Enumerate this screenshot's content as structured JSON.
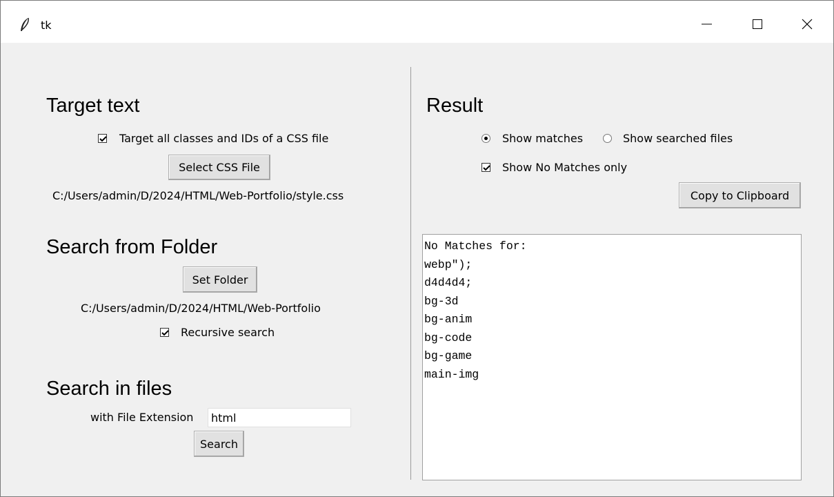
{
  "window": {
    "title": "tk",
    "icons": {
      "app": "feather-icon",
      "minimize": "minimize-icon",
      "maximize": "maximize-icon",
      "close": "close-icon"
    }
  },
  "left": {
    "target_heading": "Target text",
    "target_all_label": "Target all classes and IDs of a CSS file",
    "target_all_checked": true,
    "select_css_button": "Select CSS File",
    "css_path": "C:/Users/admin/D/2024/HTML/Web-Portfolio/style.css",
    "folder_heading": "Search from Folder",
    "set_folder_button": "Set Folder",
    "folder_path": "C:/Users/admin/D/2024/HTML/Web-Portfolio",
    "recursive_label": "Recursive search",
    "recursive_checked": true,
    "files_heading": "Search in files",
    "extension_label": "with File Extension",
    "extension_value": "html",
    "search_button": "Search"
  },
  "right": {
    "result_heading": "Result",
    "show_matches_label": "Show matches",
    "show_searched_label": "Show searched files",
    "selected_mode": "Show matches",
    "no_matches_only_label": "Show No Matches only",
    "no_matches_only_checked": true,
    "copy_button": "Copy to Clipboard",
    "result_lines": [
      "No Matches for:",
      "webp\");",
      "d4d4d4;",
      "bg-3d",
      "bg-anim",
      "bg-code",
      "bg-game",
      "main-img"
    ]
  }
}
